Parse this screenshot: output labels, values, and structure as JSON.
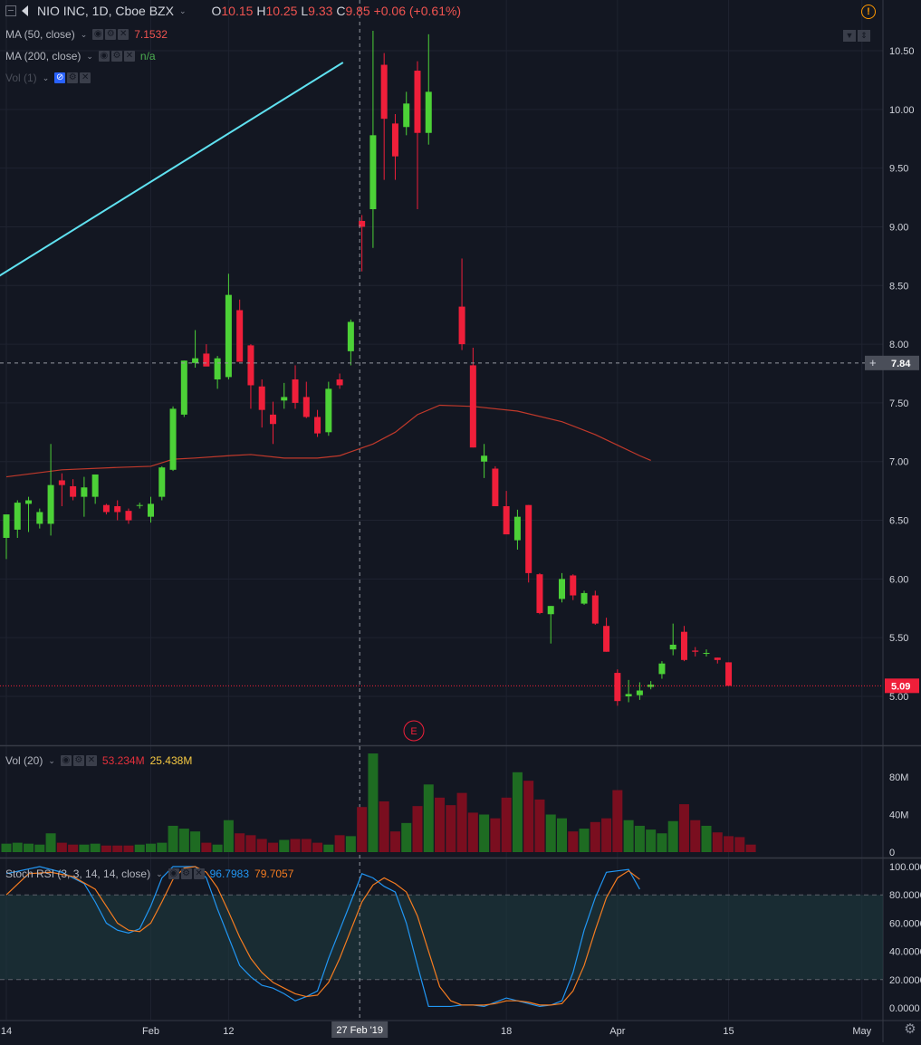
{
  "header": {
    "symbol": "NIO INC, 1D, Cboe BZX",
    "o_label": "O",
    "o_value": "10.15",
    "h_label": "H",
    "h_value": "10.25",
    "l_label": "L",
    "l_value": "9.33",
    "c_label": "C",
    "c_value": "9.85",
    "change": "+0.06 (+0.61%)"
  },
  "indicators": {
    "ma50": {
      "label": "MA (50, close)",
      "value": "7.1532"
    },
    "ma200": {
      "label": "MA (200, close)",
      "value": "n/a"
    },
    "vol_main": {
      "label": "Vol (1)"
    },
    "vol20": {
      "label": "Vol (20)",
      "value1": "53.234M",
      "value2": "25.438M"
    },
    "stoch": {
      "label": "Stoch RSI (3, 3, 14, 14, close)",
      "k": "96.7983",
      "d": "79.7057"
    }
  },
  "price_labels": {
    "crosshair": "7.84",
    "last": "5.09"
  },
  "earnings_marker": "E",
  "crosshair_date": "27 Feb '19",
  "colors": {
    "up": "#4cd137",
    "down": "#ef1f3a",
    "trendline": "#5fe1f0",
    "ma50": "#c0392b",
    "k_line": "#2196f3",
    "d_line": "#f57c20",
    "vol_up": "#1e6b22",
    "vol_down": "#7a0e1f",
    "crosshair_price_bg": "#4a4e59",
    "last_price_bg": "#ef1f3a",
    "stoch_band": "#1e3a40"
  },
  "icons": [
    "collapse-icon",
    "flag-icon",
    "eye-icon",
    "gear-icon",
    "close-icon",
    "hidden-eye-icon",
    "alert-icon",
    "scroll-up-icon",
    "scroll-down-icon",
    "settings-gear-icon"
  ],
  "chart_data": [
    {
      "type": "candlestick",
      "title": "NIO INC, 1D, Cboe BZX",
      "y_ticks": [
        "5.00",
        "5.50",
        "6.00",
        "6.50",
        "7.00",
        "7.50",
        "8.00",
        "8.50",
        "9.00",
        "9.50",
        "10.00",
        "10.50"
      ],
      "x_ticks": [
        "14",
        "Feb",
        "12",
        "18",
        "Apr",
        "15",
        "May"
      ],
      "x_tick_index": [
        0,
        13,
        20,
        45,
        55,
        65,
        77
      ],
      "candles": [
        {
          "o": 6.35,
          "h": 6.55,
          "l": 6.17,
          "c": 6.55
        },
        {
          "o": 6.42,
          "h": 6.67,
          "l": 6.35,
          "c": 6.65
        },
        {
          "o": 6.64,
          "h": 6.7,
          "l": 6.4,
          "c": 6.67
        },
        {
          "o": 6.47,
          "h": 6.6,
          "l": 6.43,
          "c": 6.57
        },
        {
          "o": 6.47,
          "h": 7.15,
          "l": 6.37,
          "c": 6.8
        },
        {
          "o": 6.84,
          "h": 6.9,
          "l": 6.62,
          "c": 6.8
        },
        {
          "o": 6.79,
          "h": 6.85,
          "l": 6.67,
          "c": 6.7
        },
        {
          "o": 6.7,
          "h": 6.87,
          "l": 6.53,
          "c": 6.78
        },
        {
          "o": 6.7,
          "h": 6.89,
          "l": 6.64,
          "c": 6.89
        },
        {
          "o": 6.63,
          "h": 6.64,
          "l": 6.55,
          "c": 6.57
        },
        {
          "o": 6.62,
          "h": 6.67,
          "l": 6.5,
          "c": 6.57
        },
        {
          "o": 6.58,
          "h": 6.6,
          "l": 6.47,
          "c": 6.5
        },
        {
          "o": 6.63,
          "h": 6.65,
          "l": 6.6,
          "c": 6.63
        },
        {
          "o": 6.53,
          "h": 6.7,
          "l": 6.48,
          "c": 6.64
        },
        {
          "o": 6.7,
          "h": 6.96,
          "l": 6.67,
          "c": 6.95
        },
        {
          "o": 6.93,
          "h": 7.47,
          "l": 6.92,
          "c": 7.45
        },
        {
          "o": 7.4,
          "h": 7.86,
          "l": 7.38,
          "c": 7.86
        },
        {
          "o": 7.84,
          "h": 8.12,
          "l": 7.8,
          "c": 7.88
        },
        {
          "o": 7.92,
          "h": 8.0,
          "l": 7.83,
          "c": 7.81
        },
        {
          "o": 7.7,
          "h": 7.9,
          "l": 7.62,
          "c": 7.88
        },
        {
          "o": 7.72,
          "h": 8.6,
          "l": 7.7,
          "c": 8.42
        },
        {
          "o": 8.29,
          "h": 8.38,
          "l": 7.88,
          "c": 7.85
        },
        {
          "o": 7.99,
          "h": 8.0,
          "l": 7.45,
          "c": 7.65
        },
        {
          "o": 7.64,
          "h": 7.7,
          "l": 7.29,
          "c": 7.44
        },
        {
          "o": 7.4,
          "h": 7.51,
          "l": 7.15,
          "c": 7.32
        },
        {
          "o": 7.52,
          "h": 7.67,
          "l": 7.45,
          "c": 7.55
        },
        {
          "o": 7.7,
          "h": 7.82,
          "l": 7.45,
          "c": 7.5
        },
        {
          "o": 7.55,
          "h": 7.68,
          "l": 7.37,
          "c": 7.38
        },
        {
          "o": 7.38,
          "h": 7.44,
          "l": 7.21,
          "c": 7.24
        },
        {
          "o": 7.25,
          "h": 7.68,
          "l": 7.22,
          "c": 7.62
        },
        {
          "o": 7.7,
          "h": 7.75,
          "l": 7.62,
          "c": 7.65
        },
        {
          "o": 7.94,
          "h": 8.21,
          "l": 7.82,
          "c": 8.19
        },
        {
          "o": 9.05,
          "h": 9.1,
          "l": 8.62,
          "c": 9.0
        },
        {
          "o": 9.15,
          "h": 10.67,
          "l": 8.82,
          "c": 9.78
        },
        {
          "o": 10.38,
          "h": 10.48,
          "l": 9.4,
          "c": 9.92
        },
        {
          "o": 9.88,
          "h": 9.96,
          "l": 9.4,
          "c": 9.6
        },
        {
          "o": 9.85,
          "h": 10.15,
          "l": 9.78,
          "c": 10.05
        },
        {
          "o": 10.33,
          "h": 10.41,
          "l": 9.15,
          "c": 9.8
        },
        {
          "o": 9.8,
          "h": 10.64,
          "l": 9.7,
          "c": 10.15
        },
        null,
        null,
        {
          "o": 8.32,
          "h": 8.73,
          "l": 7.95,
          "c": 8.0
        },
        {
          "o": 7.82,
          "h": 7.97,
          "l": 7.12,
          "c": 7.12
        },
        {
          "o": 7.0,
          "h": 7.15,
          "l": 6.86,
          "c": 7.05
        },
        {
          "o": 6.94,
          "h": 6.96,
          "l": 6.62,
          "c": 6.62
        },
        {
          "o": 6.62,
          "h": 6.75,
          "l": 6.39,
          "c": 6.38
        },
        {
          "o": 6.33,
          "h": 6.59,
          "l": 6.25,
          "c": 6.53
        },
        {
          "o": 6.63,
          "h": 6.63,
          "l": 5.97,
          "c": 6.05
        },
        {
          "o": 6.04,
          "h": 6.05,
          "l": 5.7,
          "c": 5.71
        },
        {
          "o": 5.7,
          "h": 5.77,
          "l": 5.45,
          "c": 5.77
        },
        {
          "o": 5.83,
          "h": 6.05,
          "l": 5.8,
          "c": 6.0
        },
        {
          "o": 6.03,
          "h": 6.04,
          "l": 5.82,
          "c": 5.86
        },
        {
          "o": 5.79,
          "h": 5.9,
          "l": 5.78,
          "c": 5.88
        },
        {
          "o": 5.86,
          "h": 5.9,
          "l": 5.61,
          "c": 5.62
        },
        {
          "o": 5.6,
          "h": 5.67,
          "l": 5.38,
          "c": 5.38
        },
        {
          "o": 5.2,
          "h": 5.23,
          "l": 4.92,
          "c": 4.96
        },
        {
          "o": 5.0,
          "h": 5.14,
          "l": 4.95,
          "c": 5.02
        },
        {
          "o": 5.01,
          "h": 5.12,
          "l": 4.97,
          "c": 5.05
        },
        {
          "o": 5.08,
          "h": 5.13,
          "l": 5.06,
          "c": 5.1
        },
        {
          "o": 5.19,
          "h": 5.3,
          "l": 5.15,
          "c": 5.28
        },
        {
          "o": 5.4,
          "h": 5.62,
          "l": 5.35,
          "c": 5.44
        },
        {
          "o": 5.55,
          "h": 5.6,
          "l": 5.3,
          "c": 5.31
        },
        {
          "o": 5.39,
          "h": 5.42,
          "l": 5.34,
          "c": 5.38
        },
        {
          "o": 5.37,
          "h": 5.4,
          "l": 5.34,
          "c": 5.37
        },
        {
          "o": 5.33,
          "h": 5.33,
          "l": 5.28,
          "c": 5.31
        },
        {
          "o": 5.29,
          "h": 5.29,
          "l": 5.09,
          "c": 5.09
        }
      ],
      "ma50": [
        [
          0,
          6.87
        ],
        [
          5,
          6.93
        ],
        [
          10,
          6.95
        ],
        [
          13,
          6.96
        ],
        [
          15,
          7.02
        ],
        [
          17,
          7.03
        ],
        [
          20,
          7.05
        ],
        [
          22,
          7.06
        ],
        [
          25,
          7.03
        ],
        [
          28,
          7.03
        ],
        [
          30,
          7.05
        ],
        [
          33,
          7.15
        ],
        [
          35,
          7.25
        ],
        [
          37,
          7.4
        ],
        [
          39,
          7.48
        ],
        [
          42,
          7.47
        ],
        [
          46,
          7.43
        ],
        [
          50,
          7.34
        ],
        [
          53,
          7.23
        ],
        [
          55,
          7.14
        ],
        [
          57,
          7.05
        ],
        [
          58,
          7.01
        ]
      ],
      "trendline": [
        [
          -1,
          8.56
        ],
        [
          30.3,
          10.4
        ]
      ],
      "crosshair": {
        "index": 31.8,
        "price": 7.84
      },
      "last_price": 5.09
    },
    {
      "type": "bar",
      "title": "Vol (20)",
      "y_ticks": [
        "0",
        "40M",
        "80M"
      ],
      "volumes": [
        9,
        10,
        9,
        8,
        20,
        10,
        8,
        8,
        9,
        7,
        7,
        7,
        8,
        9,
        10,
        28,
        25,
        22,
        10,
        8,
        34,
        20,
        18,
        14,
        10,
        13,
        14,
        14,
        10,
        8,
        18,
        17,
        48,
        105,
        54,
        22,
        31,
        49,
        72,
        58,
        50,
        63,
        42,
        40,
        36,
        58,
        85,
        76,
        56,
        40,
        36,
        22,
        25,
        32,
        36,
        66,
        34,
        28,
        24,
        20,
        33,
        51,
        34,
        28,
        21,
        17,
        16,
        8
      ]
    },
    {
      "type": "line",
      "title": "Stoch RSI (3, 3, 14, 14, close)",
      "y_ticks": [
        "0.0000",
        "20.0000",
        "40.0000",
        "60.0000",
        "80.0000",
        "100.0000"
      ],
      "band": [
        20,
        80
      ],
      "series": [
        {
          "name": "K",
          "points": [
            [
              0,
              95
            ],
            [
              3,
              100
            ],
            [
              5,
              96
            ],
            [
              7,
              88
            ],
            [
              8,
              75
            ],
            [
              9,
              60
            ],
            [
              10,
              55
            ],
            [
              11,
              53
            ],
            [
              12,
              56
            ],
            [
              13,
              72
            ],
            [
              14,
              92
            ],
            [
              15,
              100
            ],
            [
              16,
              100
            ],
            [
              17,
              100
            ],
            [
              18,
              92
            ],
            [
              19,
              70
            ],
            [
              20,
              50
            ],
            [
              21,
              30
            ],
            [
              22,
              22
            ],
            [
              23,
              16
            ],
            [
              24,
              14
            ],
            [
              25,
              10
            ],
            [
              26,
              5
            ],
            [
              27,
              8
            ],
            [
              28,
              12
            ],
            [
              29,
              35
            ],
            [
              30,
              55
            ],
            [
              31,
              75
            ],
            [
              32,
              95
            ],
            [
              33,
              92
            ],
            [
              34,
              86
            ],
            [
              35,
              82
            ],
            [
              36,
              60
            ],
            [
              37,
              30
            ],
            [
              38,
              1
            ],
            [
              39,
              1
            ],
            [
              40,
              1
            ],
            [
              41,
              2
            ],
            [
              42,
              2
            ],
            [
              43,
              1
            ],
            [
              44,
              4
            ],
            [
              45,
              7
            ],
            [
              46,
              5
            ],
            [
              47,
              3
            ],
            [
              48,
              1
            ],
            [
              49,
              2
            ],
            [
              50,
              5
            ],
            [
              51,
              25
            ],
            [
              52,
              55
            ],
            [
              53,
              78
            ],
            [
              54,
              96
            ],
            [
              55,
              97
            ],
            [
              56,
              98
            ],
            [
              57,
              84
            ]
          ]
        },
        {
          "name": "D",
          "points": [
            [
              0,
              80
            ],
            [
              2,
              95
            ],
            [
              4,
              96
            ],
            [
              6,
              93
            ],
            [
              8,
              84
            ],
            [
              9,
              72
            ],
            [
              10,
              60
            ],
            [
              11,
              55
            ],
            [
              12,
              54
            ],
            [
              13,
              60
            ],
            [
              14,
              75
            ],
            [
              15,
              91
            ],
            [
              16,
              99
            ],
            [
              17,
              100
            ],
            [
              18,
              96
            ],
            [
              19,
              85
            ],
            [
              20,
              68
            ],
            [
              21,
              50
            ],
            [
              22,
              35
            ],
            [
              23,
              25
            ],
            [
              24,
              18
            ],
            [
              25,
              14
            ],
            [
              26,
              10
            ],
            [
              27,
              8
            ],
            [
              28,
              9
            ],
            [
              29,
              18
            ],
            [
              30,
              35
            ],
            [
              31,
              55
            ],
            [
              32,
              75
            ],
            [
              33,
              87
            ],
            [
              34,
              92
            ],
            [
              35,
              88
            ],
            [
              36,
              82
            ],
            [
              37,
              65
            ],
            [
              38,
              40
            ],
            [
              39,
              15
            ],
            [
              40,
              5
            ],
            [
              41,
              2
            ],
            [
              42,
              2
            ],
            [
              43,
              2
            ],
            [
              44,
              3
            ],
            [
              45,
              5
            ],
            [
              46,
              5
            ],
            [
              47,
              4
            ],
            [
              48,
              2
            ],
            [
              49,
              2
            ],
            [
              50,
              3
            ],
            [
              51,
              12
            ],
            [
              52,
              30
            ],
            [
              53,
              55
            ],
            [
              54,
              78
            ],
            [
              55,
              92
            ],
            [
              56,
              97
            ],
            [
              57,
              91
            ]
          ]
        }
      ]
    }
  ]
}
